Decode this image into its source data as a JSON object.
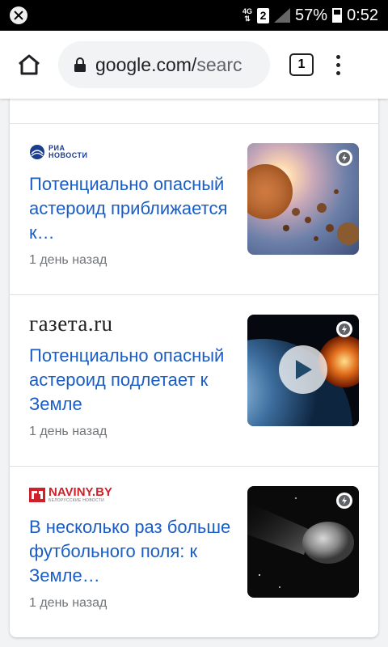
{
  "status": {
    "network": "4G",
    "sim": "2",
    "battery": "57%",
    "time": "0:52"
  },
  "browser": {
    "url_host": "google.com/",
    "url_rest": "searc",
    "tab_count": "1"
  },
  "articles": [
    {
      "source_line1": "РИА",
      "source_line2": "НОВОСТИ",
      "title": "Потенциально опасный астероид приближается к…",
      "time": "1 день назад"
    },
    {
      "source": "газета.ru",
      "title": "Потенциально опасный астероид подлетает к Земле",
      "time": "1 день назад"
    },
    {
      "source": "NAVINY.BY",
      "source_sub": "БЕЛОРУССКИЕ НОВОСТИ",
      "title": "В несколько раз больше футбольного поля: к Земле…",
      "time": "1 день назад"
    }
  ],
  "colors": {
    "link": "#1a5dc5",
    "ria_blue": "#1b3d8f",
    "naviny_red": "#d0202a"
  }
}
